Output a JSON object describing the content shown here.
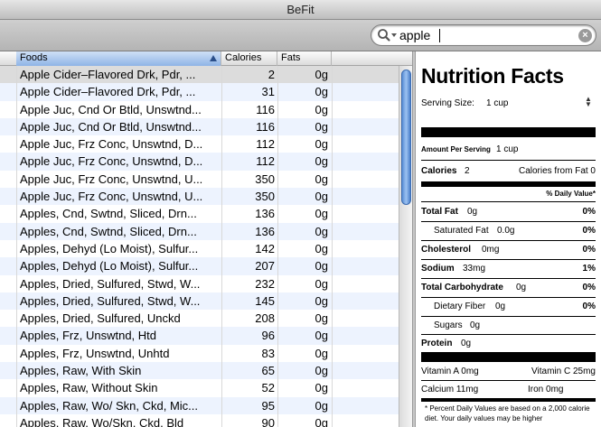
{
  "window": {
    "title": "BeFit"
  },
  "search": {
    "value": "apple",
    "placeholder": ""
  },
  "table": {
    "columns": {
      "foods": "Foods",
      "calories": "Calories",
      "fats": "Fats"
    },
    "rows": [
      {
        "food": "Apple Cider–Flavored Drk, Pdr, ...",
        "calories": "2",
        "fats": "0g"
      },
      {
        "food": "Apple Cider–Flavored Drk, Pdr, ...",
        "calories": "31",
        "fats": "0g"
      },
      {
        "food": "Apple Juc, Cnd Or Btld, Unswtnd...",
        "calories": "116",
        "fats": "0g"
      },
      {
        "food": "Apple Juc, Cnd Or Btld, Unswtnd...",
        "calories": "116",
        "fats": "0g"
      },
      {
        "food": "Apple Juc, Frz Conc, Unswtnd, D...",
        "calories": "112",
        "fats": "0g"
      },
      {
        "food": "Apple Juc, Frz Conc, Unswtnd, D...",
        "calories": "112",
        "fats": "0g"
      },
      {
        "food": "Apple Juc, Frz Conc, Unswtnd, U...",
        "calories": "350",
        "fats": "0g"
      },
      {
        "food": "Apple Juc, Frz Conc, Unswtnd, U...",
        "calories": "350",
        "fats": "0g"
      },
      {
        "food": "Apples, Cnd, Swtnd, Sliced, Drn...",
        "calories": "136",
        "fats": "0g"
      },
      {
        "food": "Apples, Cnd, Swtnd, Sliced, Drn...",
        "calories": "136",
        "fats": "0g"
      },
      {
        "food": "Apples, Dehyd (Lo Moist), Sulfur...",
        "calories": "142",
        "fats": "0g"
      },
      {
        "food": "Apples, Dehyd (Lo Moist), Sulfur...",
        "calories": "207",
        "fats": "0g"
      },
      {
        "food": "Apples, Dried, Sulfured, Stwd, W...",
        "calories": "232",
        "fats": "0g"
      },
      {
        "food": "Apples, Dried, Sulfured, Stwd, W...",
        "calories": "145",
        "fats": "0g"
      },
      {
        "food": "Apples, Dried, Sulfured, Unckd",
        "calories": "208",
        "fats": "0g"
      },
      {
        "food": "Apples, Frz, Unswtnd, Htd",
        "calories": "96",
        "fats": "0g"
      },
      {
        "food": "Apples, Frz, Unswtnd, Unhtd",
        "calories": "83",
        "fats": "0g"
      },
      {
        "food": "Apples, Raw, With Skin",
        "calories": "65",
        "fats": "0g"
      },
      {
        "food": "Apples, Raw, Without Skin",
        "calories": "52",
        "fats": "0g"
      },
      {
        "food": "Apples, Raw, Wo/ Skn, Ckd, Mic...",
        "calories": "95",
        "fats": "0g"
      },
      {
        "food": "Apples, Raw, Wo/Skn, Ckd, Bld",
        "calories": "90",
        "fats": "0g"
      }
    ]
  },
  "nutrition": {
    "title": "Nutrition Facts",
    "serving_size_label": "Serving Size:",
    "serving_size_value": "1 cup",
    "amount_per_serving_label": "Amount Per Serving",
    "amount_per_serving_value": "1 cup",
    "calories_label": "Calories",
    "calories_value": "2",
    "calories_from_fat": "Calories from Fat 0",
    "daily_value_header": "% Daily Value*",
    "total_fat_label": "Total Fat",
    "total_fat_value": "0g",
    "total_fat_pct": "0%",
    "saturated_fat_label": "Saturated Fat",
    "saturated_fat_value": "0.0g",
    "saturated_fat_pct": "0%",
    "cholesterol_label": "Cholesterol",
    "cholesterol_value": "0mg",
    "cholesterol_pct": "0%",
    "sodium_label": "Sodium",
    "sodium_value": "33mg",
    "sodium_pct": "1%",
    "total_carb_label": "Total Carbohydrate",
    "total_carb_value": "0g",
    "total_carb_pct": "0%",
    "fiber_label": "Dietary Fiber",
    "fiber_value": "0g",
    "fiber_pct": "0%",
    "sugars_label": "Sugars",
    "sugars_value": "0g",
    "protein_label": "Protein",
    "protein_value": "0g",
    "vitamin_a": "Vitamin A 0mg",
    "vitamin_c": "Vitamin C 25mg",
    "calcium": "Calcium 11mg",
    "iron": "Iron 0mg",
    "footnote": "* Percent Daily Values are based on a 2,000 calorie diet. Your daily values may be higher"
  },
  "colors": {
    "selected_row": "#dcdcdc",
    "alt_row": "#edf3fe",
    "scroll_thumb": "#5a8fd6"
  }
}
